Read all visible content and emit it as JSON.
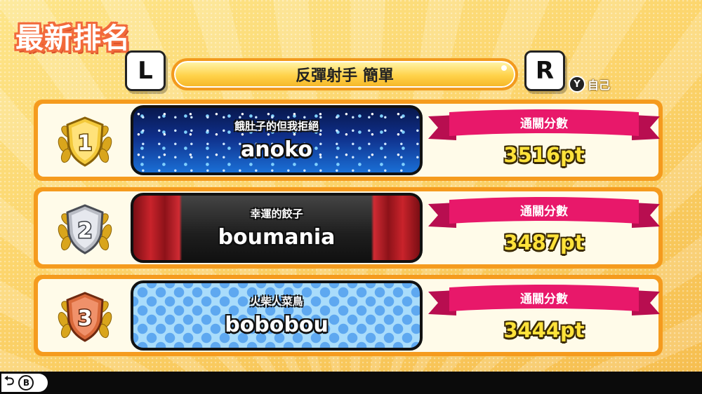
{
  "page": {
    "title": "最新排名"
  },
  "controls": {
    "prev_key": "L",
    "next_key": "R",
    "self_button": "Y",
    "self_label": "自己",
    "back_button": "B",
    "back_icon": "return-arrow-icon"
  },
  "mode": {
    "label": "反彈射手 簡單"
  },
  "score_header": "通關分數",
  "ranking": [
    {
      "rank": "1",
      "medal": "gold",
      "title": "餓肚子的但我拒絕",
      "name": "anoko",
      "score": "3516pt",
      "theme": "stars"
    },
    {
      "rank": "2",
      "medal": "silver",
      "title": "幸運的餃子",
      "name": "boumania",
      "score": "3487pt",
      "theme": "curtain"
    },
    {
      "rank": "3",
      "medal": "bronze",
      "title": "火柴人菜鳥",
      "name": "bobobou",
      "score": "3444pt",
      "theme": "dots"
    }
  ],
  "colors": {
    "gold": "#e9b820",
    "silver": "#b9bcc4",
    "bronze": "#d9693a",
    "ribbon": "#e8186a",
    "row_border": "#f59b1e"
  }
}
